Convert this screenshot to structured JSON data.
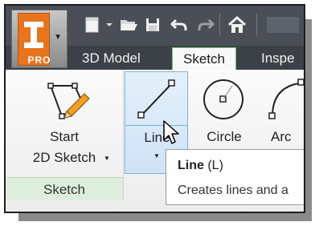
{
  "app": {
    "badge": "PRO",
    "logo_letter": "I"
  },
  "quick_access": {
    "icons": [
      "new-file-icon",
      "dropdown-icon",
      "open-folder-icon",
      "save-icon",
      "undo-icon",
      "redo-icon",
      "home-icon"
    ]
  },
  "tabs": [
    {
      "label": "3D Model",
      "active": false
    },
    {
      "label": "Sketch",
      "active": true
    },
    {
      "label": "Inspe",
      "active": false
    }
  ],
  "ribbon": {
    "start_sketch": {
      "label_line1": "Start",
      "label_line2": "2D Sketch"
    },
    "line": {
      "label": "Line"
    },
    "circle": {
      "label": "Circle"
    },
    "arc": {
      "label": "Arc"
    },
    "panel_label": "Sketch"
  },
  "tooltip": {
    "title": "Line",
    "shortcut": "(L)",
    "description": "Creates lines and a"
  },
  "colors": {
    "accent_green": "#6ec66e",
    "hover_blue": "#7fb0d8",
    "brand_orange": "#e8741e"
  }
}
